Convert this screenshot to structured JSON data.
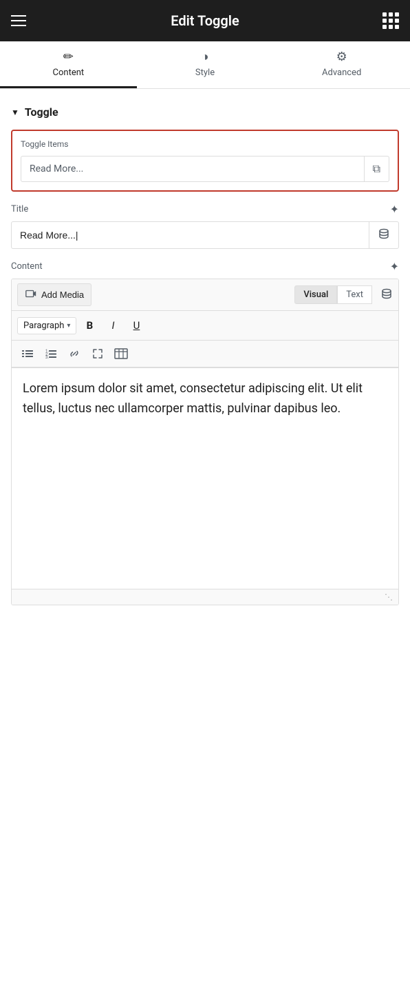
{
  "header": {
    "title": "Edit Toggle",
    "hamburger_label": "menu",
    "grid_label": "apps"
  },
  "tabs": [
    {
      "id": "content",
      "label": "Content",
      "icon": "✏️",
      "active": true
    },
    {
      "id": "style",
      "label": "Style",
      "icon": "◑",
      "active": false
    },
    {
      "id": "advanced",
      "label": "Advanced",
      "icon": "⚙",
      "active": false
    }
  ],
  "section": {
    "title": "Toggle",
    "toggle_items_label": "Toggle Items",
    "toggle_item_text": "Read More...",
    "title_field_label": "Title",
    "title_value": "Read More...|",
    "content_field_label": "Content"
  },
  "editor": {
    "add_media_label": "Add Media",
    "visual_tab": "Visual",
    "text_tab": "Text",
    "paragraph_label": "Paragraph",
    "bold_label": "B",
    "italic_label": "I",
    "underline_label": "U",
    "content_text": "Lorem ipsum dolor sit amet, consectetur adipiscing elit. Ut elit tellus, luctus nec ullamcorper mattis, pulvinar dapibus leo."
  }
}
